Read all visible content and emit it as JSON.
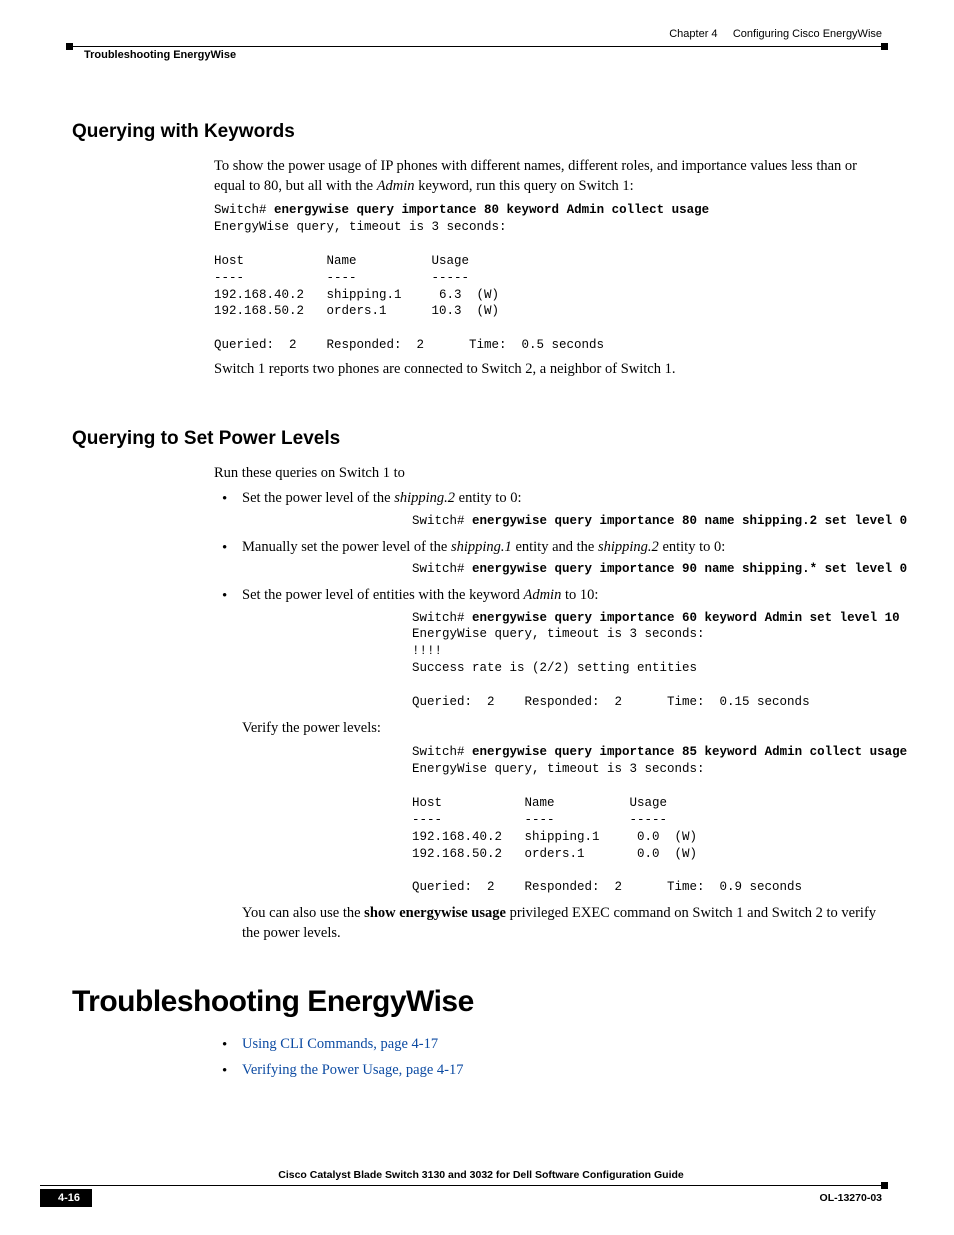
{
  "header": {
    "left": "Troubleshooting EnergyWise",
    "chapter_label": "Chapter 4",
    "chapter_title": "Configuring Cisco EnergyWise"
  },
  "s1": {
    "heading": "Querying with Keywords",
    "p1a": "To show the power usage of IP phones with different names, different roles, and importance values less than or equal to 80, but all with the ",
    "p1b": "Admin",
    "p1c": " keyword, run this query on Switch 1:",
    "code1_prompt": "Switch# ",
    "code1_cmd": "energywise query importance 80 keyword Admin collect usage",
    "code1_body": "EnergyWise query, timeout is 3 seconds:\n\nHost           Name          Usage\n----           ----          -----\n192.168.40.2   shipping.1     6.3  (W)\n192.168.50.2   orders.1      10.3  (W)\n\nQueried:  2    Responded:  2      Time:  0.5 seconds",
    "p2": "Switch 1 reports two phones are connected to Switch 2, a neighbor of Switch 1."
  },
  "s2": {
    "heading": "Querying to Set Power Levels",
    "p1": "Run these queries on Switch 1 to",
    "li1a": "Set the power level of the ",
    "li1b": "shipping.2",
    "li1c": " entity to 0:",
    "li1_code_prompt": "Switch# ",
    "li1_code_cmd": "energywise query importance 80 name shipping.2 set level 0",
    "li2a": "Manually set the power level of the ",
    "li2b": "shipping.1",
    "li2c": " entity and the ",
    "li2d": "shipping.2",
    "li2e": " entity to 0:",
    "li2_code_prompt": "Switch# ",
    "li2_code_cmd": "energywise query importance 90 name shipping.* set level 0",
    "li3a": "Set the power level of entities with the keyword ",
    "li3b": "Admin",
    "li3c": " to 10:",
    "li3_code_prompt": "Switch# ",
    "li3_code_cmd": "energywise query importance 60 keyword Admin set level 10",
    "li3_code_body": "EnergyWise query, timeout is 3 seconds:\n!!!!\nSuccess rate is (2/2) setting entities\n\nQueried:  2    Responded:  2      Time:  0.15 seconds",
    "li3_verify": "Verify the power levels:",
    "li3_code2_prompt": "Switch# ",
    "li3_code2_cmd": "energywise query importance 85 keyword Admin collect usage",
    "li3_code2_body": "EnergyWise query, timeout is 3 seconds:\n\nHost           Name          Usage\n----           ----          -----\n192.168.40.2   shipping.1     0.0  (W)\n192.168.50.2   orders.1       0.0  (W)\n\nQueried:  2    Responded:  2      Time:  0.9 seconds",
    "p2a": "You can also use the ",
    "p2b": "show energywise usage",
    "p2c": " privileged EXEC command on Switch 1 and Switch 2 to verify the power levels."
  },
  "s3": {
    "heading": "Troubleshooting EnergyWise",
    "link1": "Using CLI Commands, page 4-17",
    "link2": "Verifying the Power Usage, page 4-17"
  },
  "footer": {
    "title": "Cisco Catalyst Blade Switch 3130 and 3032 for Dell Software Configuration Guide",
    "page": "4-16",
    "docnum": "OL-13270-03"
  }
}
